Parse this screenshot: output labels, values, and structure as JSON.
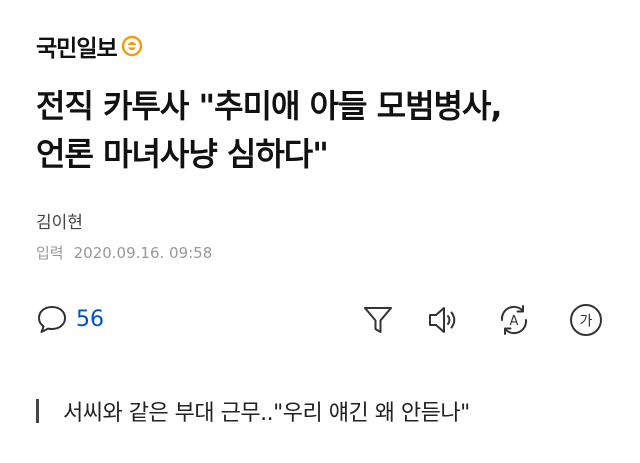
{
  "brand": {
    "name": "국민일보",
    "logo_icon": "orange-circle-logo-icon",
    "accent": "#f39c12"
  },
  "article": {
    "title_line1": "전직 카투사 \"추미애 아들 모범병사,",
    "title_line2": "언론 마녀사냥 심하다\"",
    "author": "김이현",
    "date_label": "입력",
    "date_value": "2020.09.16. 09:58",
    "subheading": "서씨와 같은 부대 근무..\"우리 얘긴 왜 안듣나\""
  },
  "toolbar": {
    "comment_count": "56",
    "comment_color": "#0050c8",
    "icons": [
      "comment-icon",
      "funnel-icon",
      "speaker-icon",
      "translate-icon",
      "font-size-icon"
    ],
    "font_size_glyph": "가",
    "translate_glyph": "A"
  }
}
